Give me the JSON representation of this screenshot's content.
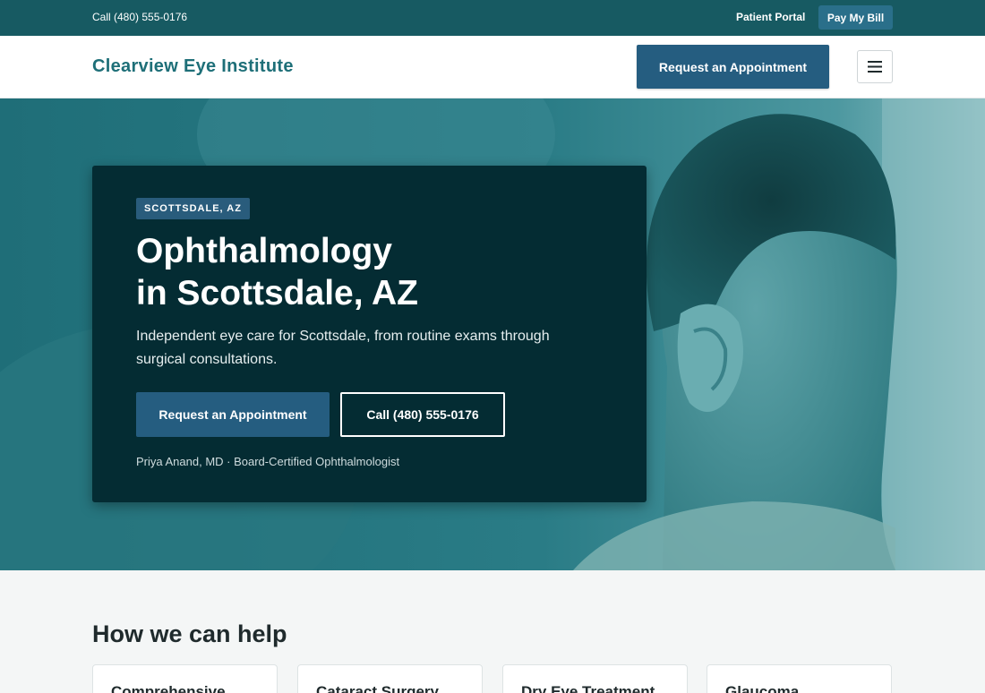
{
  "topbar": {
    "phone": "Call (480) 555-0176",
    "patient_portal": "Patient Portal",
    "pay_bill": "Pay My Bill"
  },
  "header": {
    "brand": "Clearview Eye Institute",
    "cta": "Request an Appointment",
    "menu_icon": "hamburger-menu-icon"
  },
  "hero": {
    "badge": "SCOTTSDALE, AZ",
    "title_line1": "Ophthalmology",
    "title_line2": "in Scottsdale, AZ",
    "lead": "Independent eye care for Scottsdale, from routine exams through surgical consultations.",
    "primary_cta": "Request an Appointment",
    "secondary_cta": "Call (480) 555-0176",
    "doctor": "Priya Anand, MD · Board-Certified Ophthalmologist"
  },
  "services": {
    "title": "How we can help",
    "items": [
      {
        "label": "Comprehensive"
      },
      {
        "label": "Cataract Surgery"
      },
      {
        "label": "Dry Eye Treatment"
      },
      {
        "label": "Glaucoma"
      }
    ]
  },
  "colors": {
    "topbar": "#175a62",
    "brand": "#1e6f78",
    "button": "#255d80",
    "hero_card": "#042c33"
  }
}
